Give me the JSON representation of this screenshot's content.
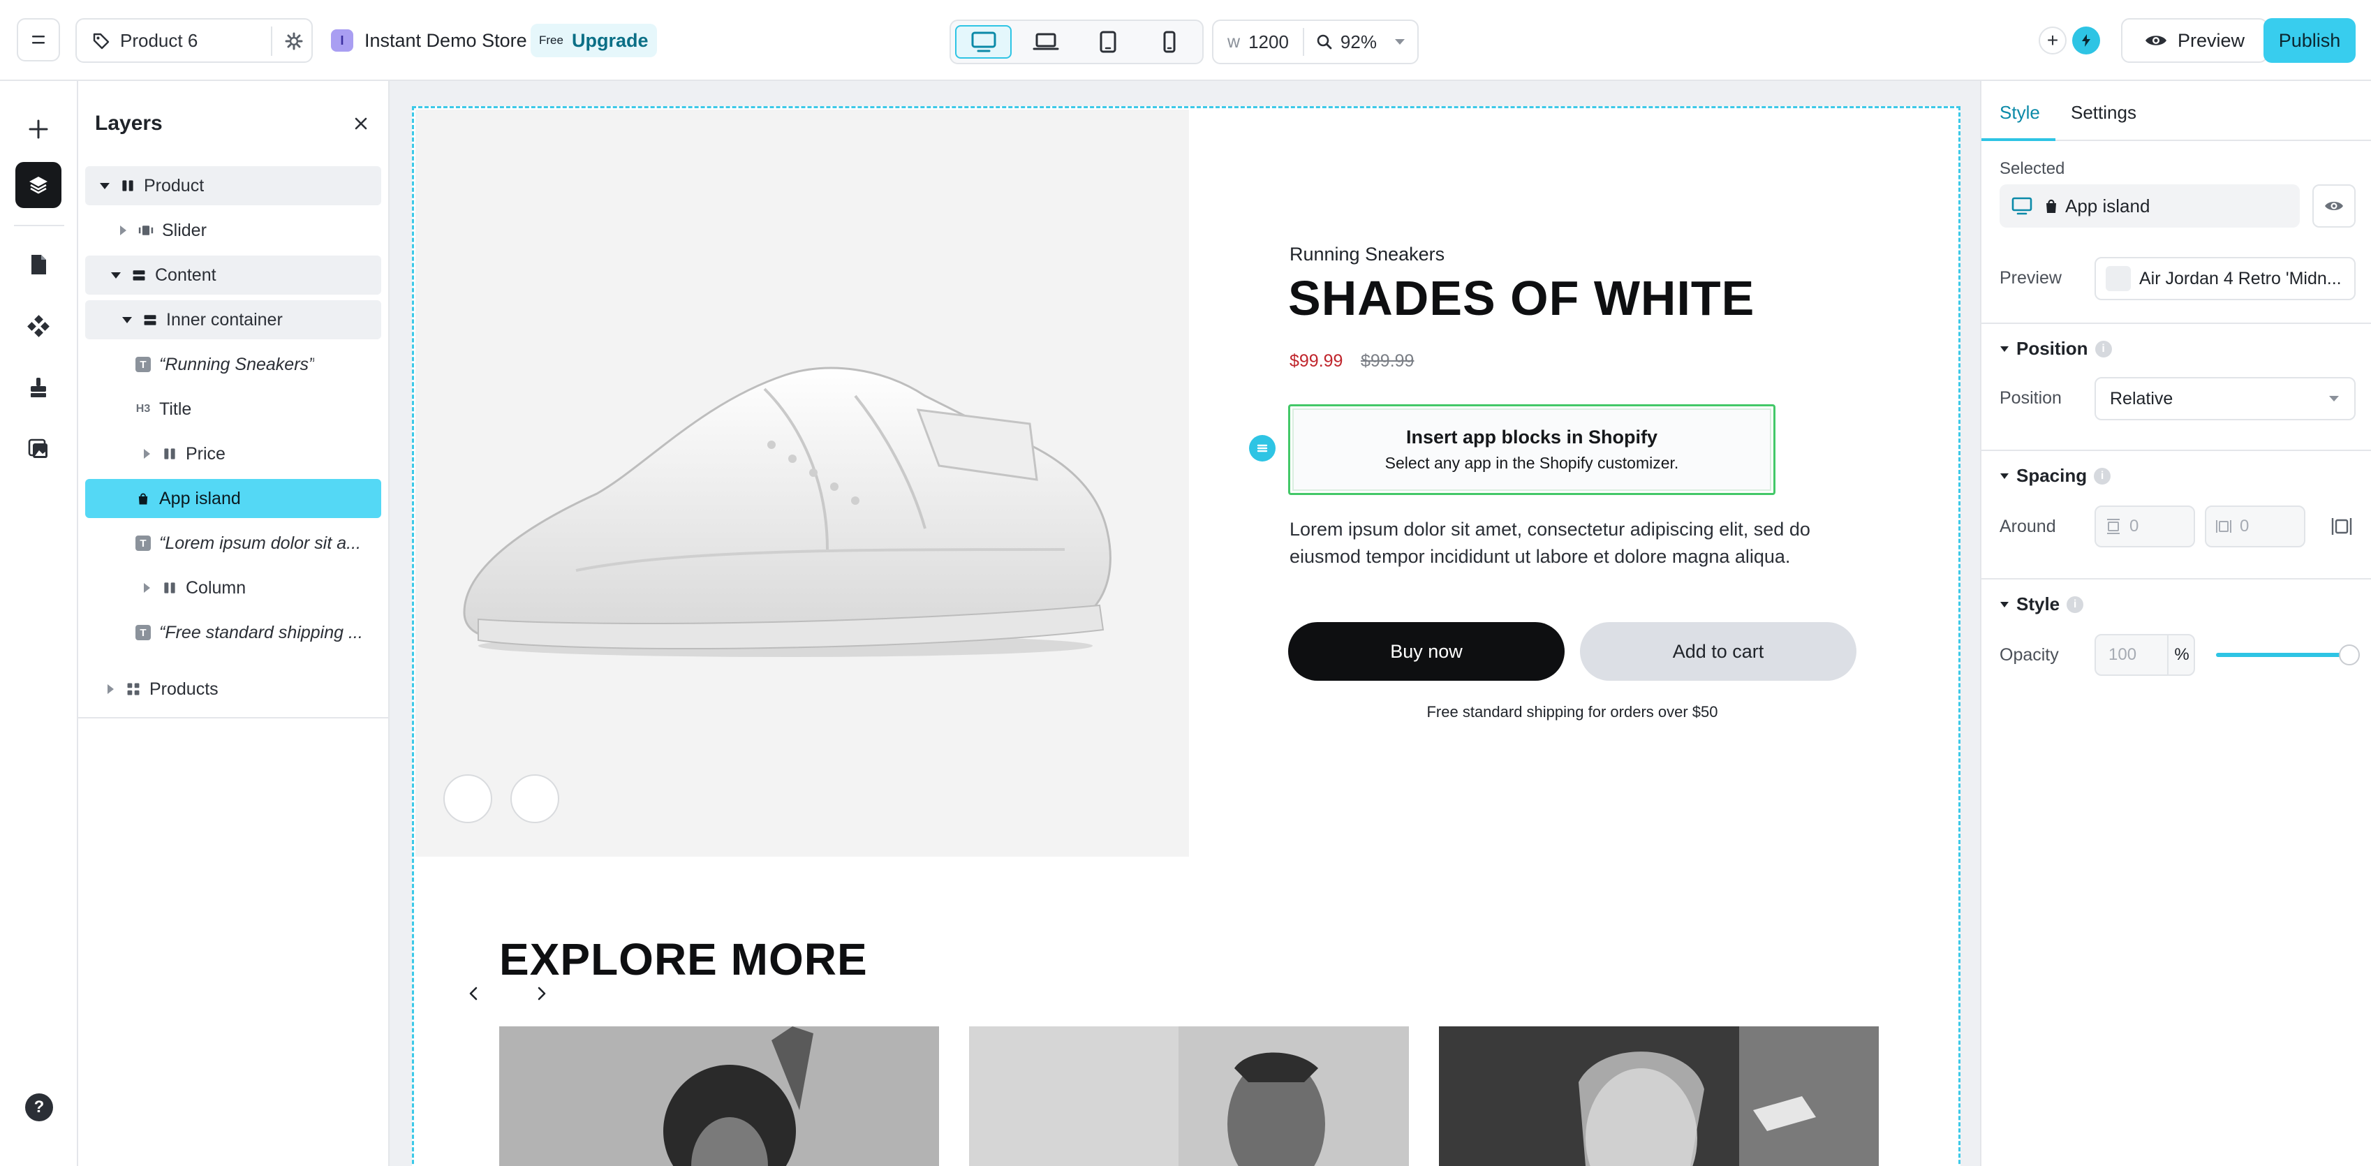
{
  "topbar": {
    "page_name": "Product 6",
    "store_initial": "I",
    "store_name": "Instant Demo Store",
    "plan_badge": "Free",
    "upgrade_label": "Upgrade",
    "width_prefix": "w",
    "width_value": "1200",
    "zoom_value": "92%",
    "preview_label": "Preview",
    "publish_label": "Publish",
    "add_symbol": "+",
    "active_device": "desktop"
  },
  "layers": {
    "title": "Layers",
    "items": [
      {
        "label": "Product"
      },
      {
        "label": "Slider"
      },
      {
        "label": "Content"
      },
      {
        "label": "Inner container"
      },
      {
        "label": "“Running Sneakers”"
      },
      {
        "label": "Title",
        "badge": "H3"
      },
      {
        "label": "Price"
      },
      {
        "label": "App island"
      },
      {
        "label": "“Lorem ipsum dolor sit a..."
      },
      {
        "label": "Column"
      },
      {
        "label": "“Free standard shipping ..."
      },
      {
        "label": "Products"
      }
    ],
    "text_badge": "T"
  },
  "canvas": {
    "eyebrow": "Running Sneakers",
    "title": "SHADES OF WHITE",
    "price": "$99.99",
    "compare_price": "$99.99",
    "app_island_title": "Insert app blocks in Shopify",
    "app_island_subtitle": "Select any app in the Shopify customizer.",
    "description": "Lorem ipsum dolor sit amet, consectetur adipiscing elit, sed do eiusmod tempor incididunt ut labore et dolore magna aliqua.",
    "buy_label": "Buy now",
    "cart_label": "Add to cart",
    "shipping_note": "Free standard shipping for orders over $50",
    "explore_title": "EXPLORE MORE"
  },
  "inspector": {
    "tabs": [
      "Style",
      "Settings"
    ],
    "selected_label": "Selected",
    "selected_name": "App island",
    "preview_label": "Preview",
    "preview_value": "Air Jordan 4 Retro 'Midn...",
    "position_section": "Position",
    "position_label": "Position",
    "position_value": "Relative",
    "spacing_section": "Spacing",
    "around_label": "Around",
    "around_value_1": "0",
    "around_value_2": "0",
    "style_section": "Style",
    "opacity_label": "Opacity",
    "opacity_value": "100",
    "opacity_unit": "%",
    "info_glyph": "i"
  },
  "colors": {
    "accent": "#2ec4e4",
    "publish": "#38cdee",
    "price_red": "#c0262d",
    "app_island_border": "#43c868"
  }
}
